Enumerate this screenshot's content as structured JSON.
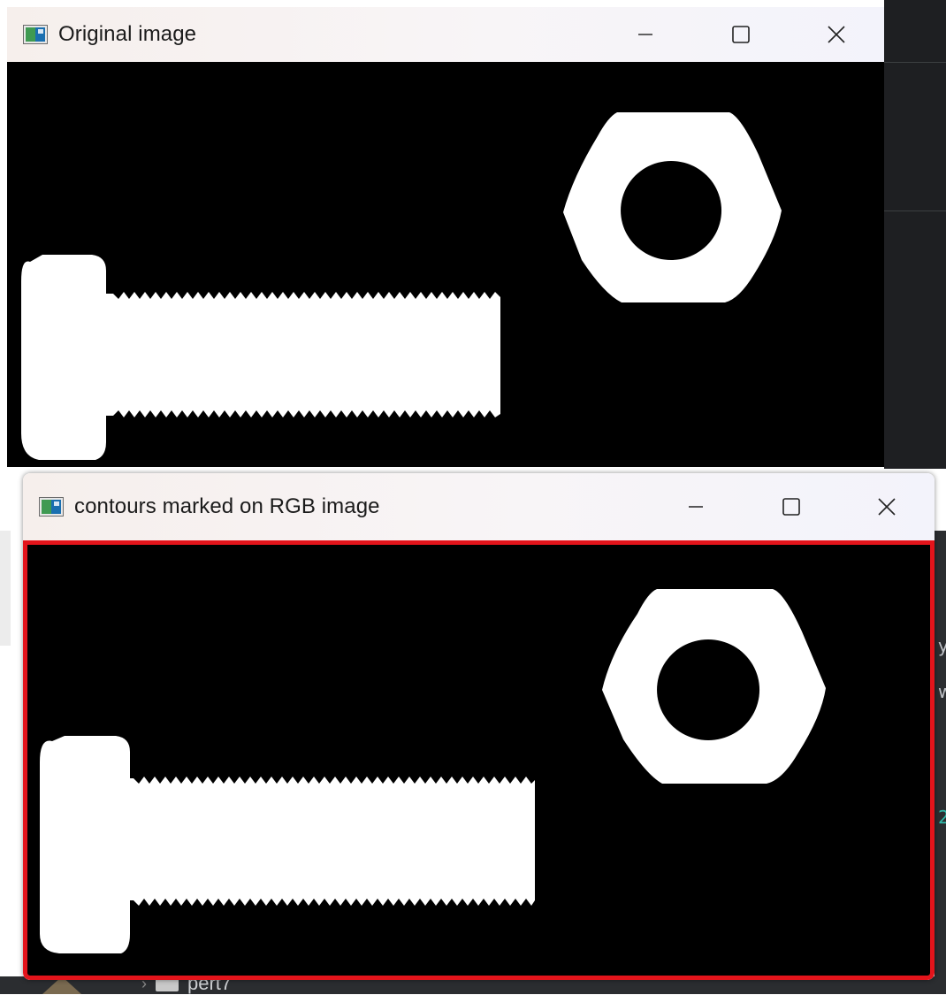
{
  "windows": [
    {
      "title": "Original image",
      "icon": "opencv-window-icon",
      "controls": [
        "minimize-icon",
        "maximize-icon",
        "close-icon"
      ]
    },
    {
      "title": "contours marked on RGB image",
      "icon": "opencv-window-icon",
      "controls": [
        "minimize-icon",
        "maximize-icon",
        "close-icon"
      ],
      "highlight_border_color": "#e3141b"
    }
  ],
  "image_colors": {
    "background": "#000000",
    "shape_fill": "#ffffff"
  },
  "background_ide": {
    "folder_label": "pert7"
  }
}
